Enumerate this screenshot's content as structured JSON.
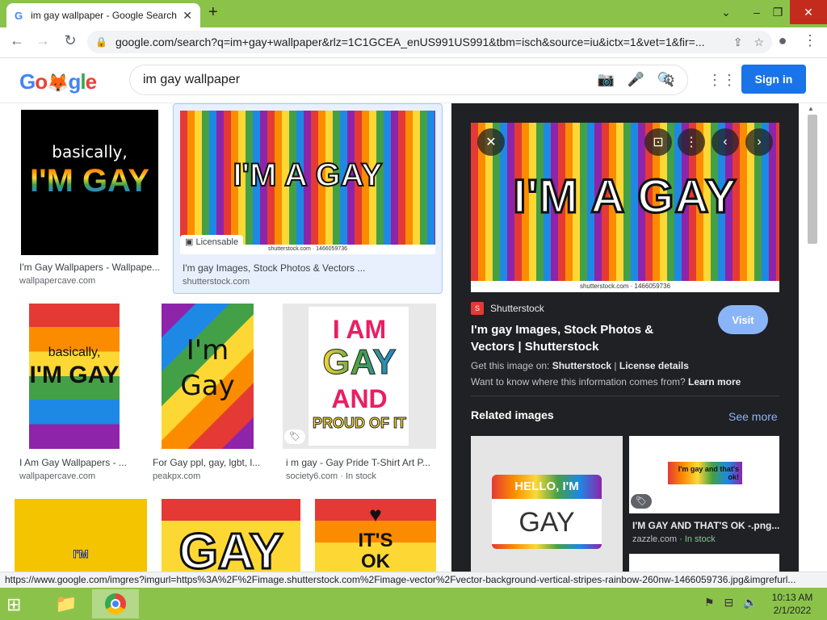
{
  "browser": {
    "tab_title": "im gay wallpaper - Google Search",
    "tab_favicon": "G",
    "url": "google.com/search?q=im+gay+wallpaper&rlz=1C1GCEA_enUS991US991&tbm=isch&source=iu&ictx=1&vet=1&fir=...",
    "status_url": "https://www.google.com/imgres?imgurl=https%3A%2F%2Fimage.shutterstock.com%2Fimage-vector%2Fvector-background-vertical-stripes-rainbow-260nw-1466059736.jpg&imgrefurl...",
    "accent": "#8bc34a"
  },
  "header": {
    "logo": "Google",
    "query": "im gay wallpaper",
    "signin": "Sign in"
  },
  "results": [
    {
      "title": "I'm Gay Wallpapers - Wallpape...",
      "source": "wallpapercave.com",
      "art": "basically,",
      "art2": "I'M GAY"
    },
    {
      "title": "I'm gay Images, Stock Photos & Vectors ...",
      "source": "shutterstock.com",
      "art": "I'M A GAY",
      "badge": "Licensable",
      "wm": "shutterstock.com · 1466059736"
    },
    {
      "title": "I Am Gay Wallpapers - ...",
      "source": "wallpapercave.com",
      "art": "basically,",
      "art2": "I'M GAY"
    },
    {
      "title": "For Gay ppl, gay, lgbt, l...",
      "source": "peakpx.com",
      "art": "I'm",
      "art2": "Gay"
    },
    {
      "title": "i m gay - Gay Pride T-Shirt Art P...",
      "source": "society6.com",
      "stock": "In stock",
      "art": "I AM",
      "art2": "GAY",
      "art3": "AND",
      "art4": "PROUD OF IT"
    },
    {
      "art": "I'M"
    },
    {
      "art": "GAY"
    },
    {
      "art": "IT'S",
      "art2": "OK"
    }
  ],
  "panel": {
    "image_text": "I'M A GAY",
    "watermark": "shutterstock.com · 1466059736",
    "source_name": "Shutterstock",
    "title": "I'm gay Images, Stock Photos & Vectors | Shutterstock",
    "visit": "Visit",
    "get_prefix": "Get this image on: ",
    "get_source": "Shutterstock",
    "get_sep": " | ",
    "license": "License details",
    "want_prefix": "Want to know where this information comes from? ",
    "learn_more": "Learn more",
    "related": "Related images",
    "see_more": "See more",
    "rel1_art1": "HELLO, I'M",
    "rel1_art2": "GAY",
    "rel2_art": "I'm gay and that's ok!",
    "rel2_title": "I'M GAY AND THAT'S OK -.png...",
    "rel2_source": "zazzle.com",
    "rel2_stock": "In stock"
  },
  "taskbar": {
    "time": "10:13 AM",
    "date": "2/1/2022"
  }
}
